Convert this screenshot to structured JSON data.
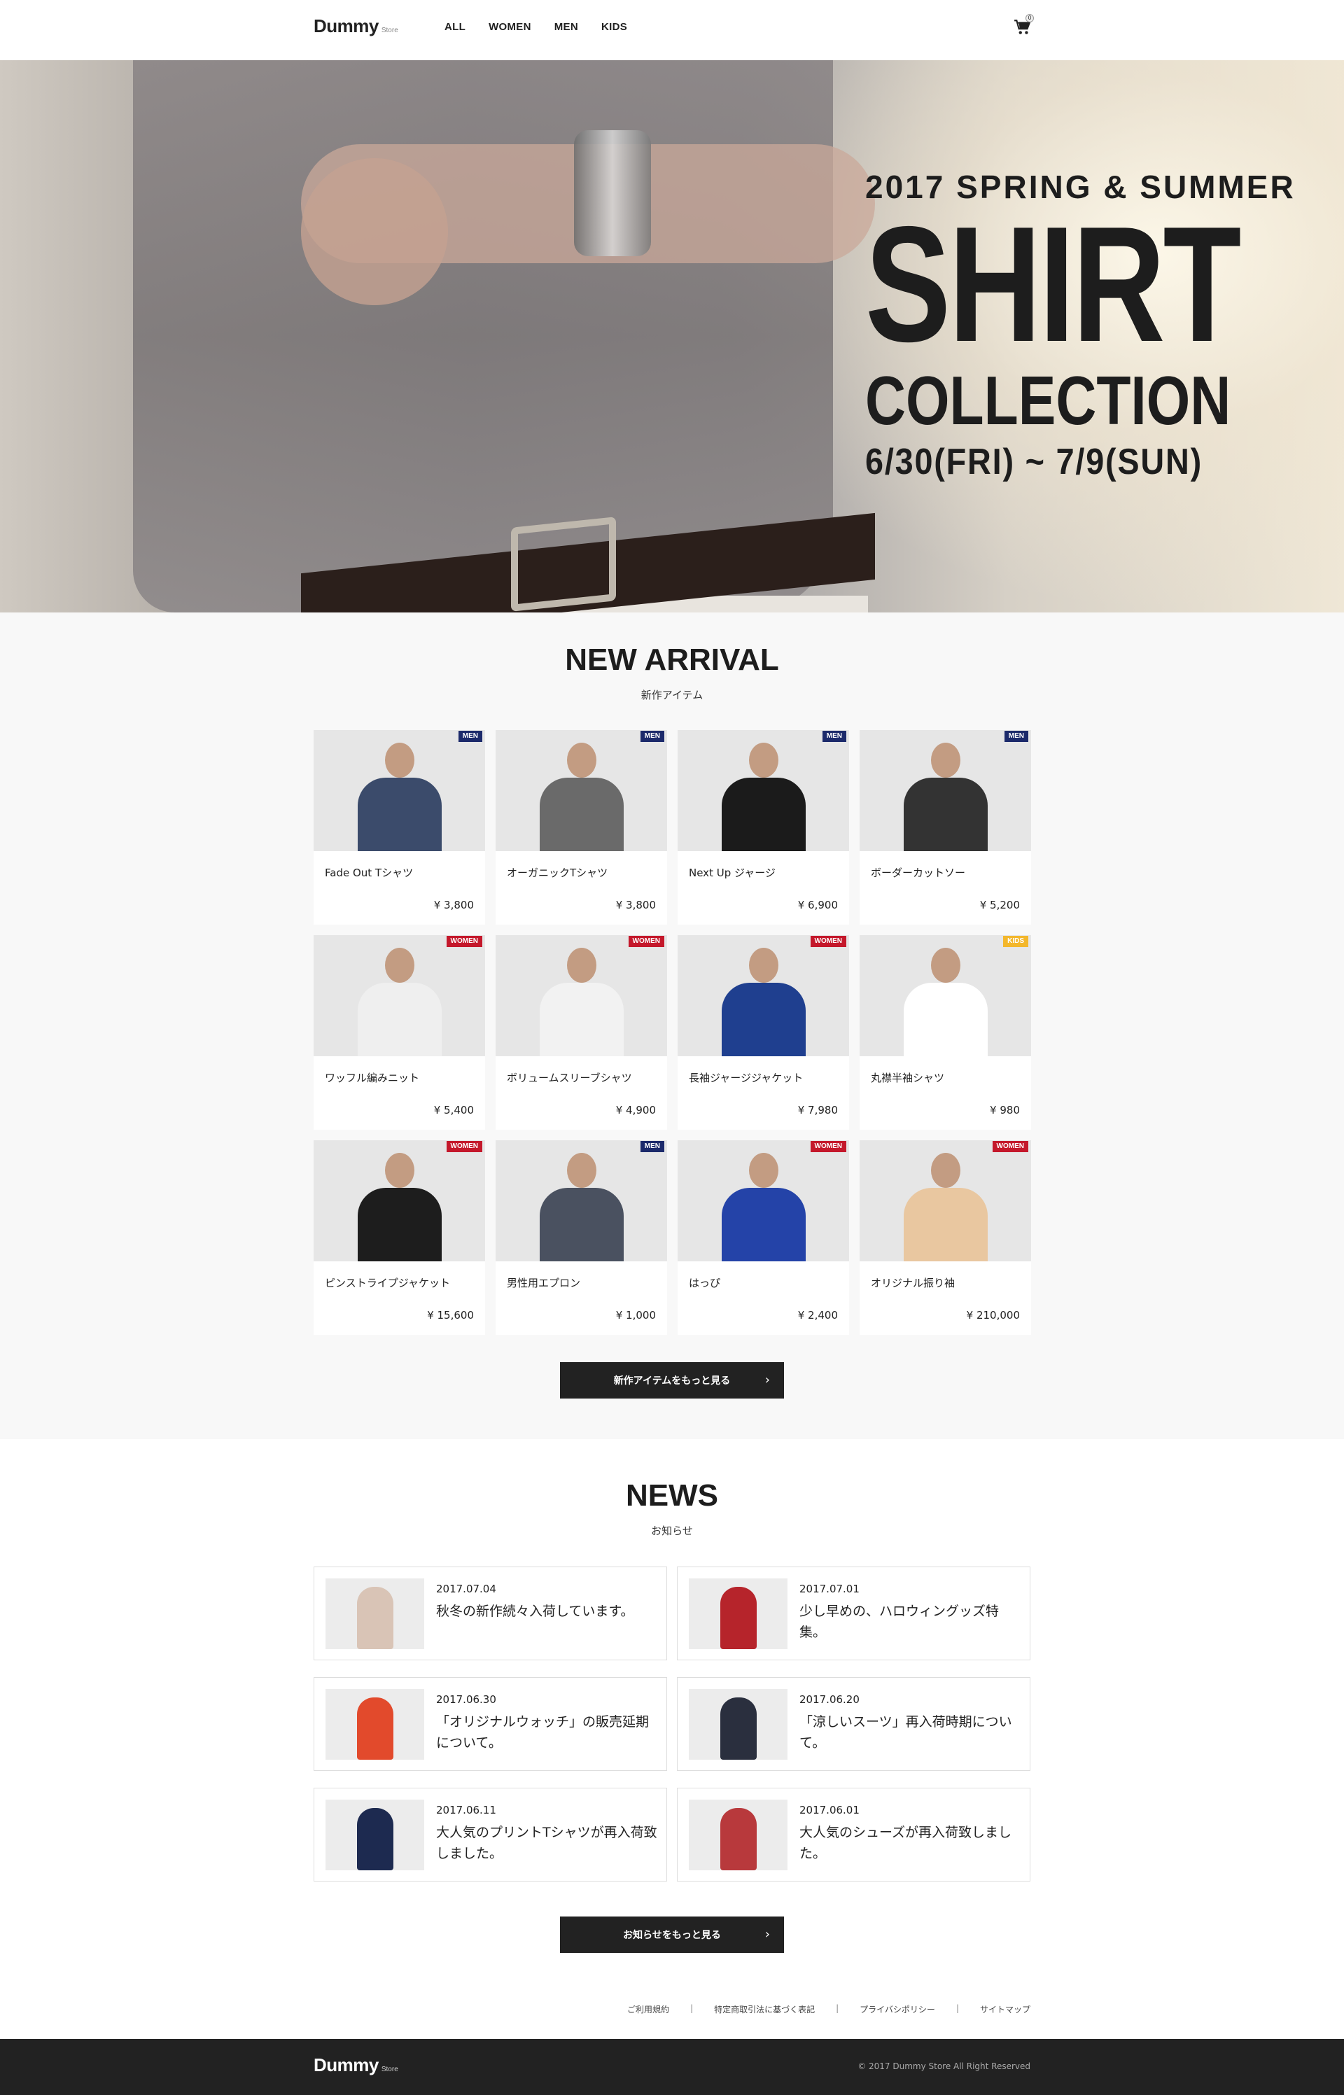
{
  "header": {
    "logo": "Dummy",
    "logo_sub": "Store",
    "nav": [
      "ALL",
      "WOMEN",
      "MEN",
      "KIDS"
    ],
    "cart_count": "0"
  },
  "hero": {
    "season": "2017 SPRING & SUMMER",
    "title": "SHIRT",
    "subtitle": "COLLECTION",
    "date": "6/30(FRI) ~ 7/9(SUN)"
  },
  "new_arrival": {
    "title": "NEW ARRIVAL",
    "subtitle": "新作アイテム",
    "button": "新作アイテムをもっと見る",
    "products": [
      {
        "name": "Fade Out Tシャツ",
        "price": "¥ 3,800",
        "tag": "MEN",
        "body_color": "#3b4b6b"
      },
      {
        "name": "オーガニックTシャツ",
        "price": "¥ 3,800",
        "tag": "MEN",
        "body_color": "#6a6a6a"
      },
      {
        "name": "Next Up ジャージ",
        "price": "¥ 6,900",
        "tag": "MEN",
        "body_color": "#1b1b1b"
      },
      {
        "name": "ボーダーカットソー",
        "price": "¥ 5,200",
        "tag": "MEN",
        "body_color": "#333333"
      },
      {
        "name": "ワッフル編みニット",
        "price": "¥ 5,400",
        "tag": "WOMEN",
        "body_color": "#efefef"
      },
      {
        "name": "ボリュームスリーブシャツ",
        "price": "¥ 4,900",
        "tag": "WOMEN",
        "body_color": "#f2f2f2"
      },
      {
        "name": "長袖ジャージジャケット",
        "price": "¥ 7,980",
        "tag": "WOMEN",
        "body_color": "#1f3f8f"
      },
      {
        "name": "丸襟半袖シャツ",
        "price": "¥ 980",
        "tag": "KIDS",
        "body_color": "#ffffff"
      },
      {
        "name": "ピンストライプジャケット",
        "price": "¥ 15,600",
        "tag": "WOMEN",
        "body_color": "#1d1d1d"
      },
      {
        "name": "男性用エプロン",
        "price": "¥ 1,000",
        "tag": "MEN",
        "body_color": "#4a5160"
      },
      {
        "name": "はっぴ",
        "price": "¥ 2,400",
        "tag": "WOMEN",
        "body_color": "#2443a8"
      },
      {
        "name": "オリジナル振り袖",
        "price": "¥ 210,000",
        "tag": "WOMEN",
        "body_color": "#e9c7a0"
      }
    ]
  },
  "news": {
    "title": "NEWS",
    "subtitle": "お知らせ",
    "button": "お知らせをもっと見る",
    "items": [
      {
        "date": "2017.07.04",
        "text": "秋冬の新作続々入荷しています。",
        "thumb_color": "#d9c4b6"
      },
      {
        "date": "2017.07.01",
        "text": "少し早めの、ハロウィングッズ特集。",
        "thumb_color": "#b6242b"
      },
      {
        "date": "2017.06.30",
        "text": "「オリジナルウォッチ」の販売延期について。",
        "thumb_color": "#e24a2c"
      },
      {
        "date": "2017.06.20",
        "text": "「涼しいスーツ」再入荷時期について。",
        "thumb_color": "#2a2f3e"
      },
      {
        "date": "2017.06.11",
        "text": "大人気のプリントTシャツが再入荷致しました。",
        "thumb_color": "#1d2a50"
      },
      {
        "date": "2017.06.01",
        "text": "大人気のシューズが再入荷致しました。",
        "thumb_color": "#b8393c"
      }
    ]
  },
  "footer": {
    "links": [
      "ご利用規約",
      "特定商取引法に基づく表記",
      "プライバシポリシー",
      "サイトマップ"
    ],
    "logo": "Dummy",
    "logo_sub": "Store",
    "copyright": "© 2017 Dummy Store All Right Reserved"
  }
}
